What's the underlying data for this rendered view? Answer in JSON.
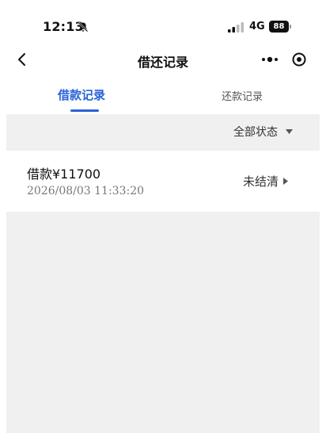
{
  "status_bar": {
    "time": "12:13",
    "network": "4G",
    "battery": "88"
  },
  "nav": {
    "title": "借还记录"
  },
  "tabs": [
    {
      "label": "借款记录",
      "active": true
    },
    {
      "label": "还款记录",
      "active": false
    }
  ],
  "filter": {
    "label": "全部状态"
  },
  "records": [
    {
      "amount": "借款¥11700",
      "datetime": "2026/08/03 11:33:20",
      "status": "未结清"
    }
  ],
  "colors": {
    "accent": "#2a62d8",
    "background_grey": "#f0f0f0"
  }
}
